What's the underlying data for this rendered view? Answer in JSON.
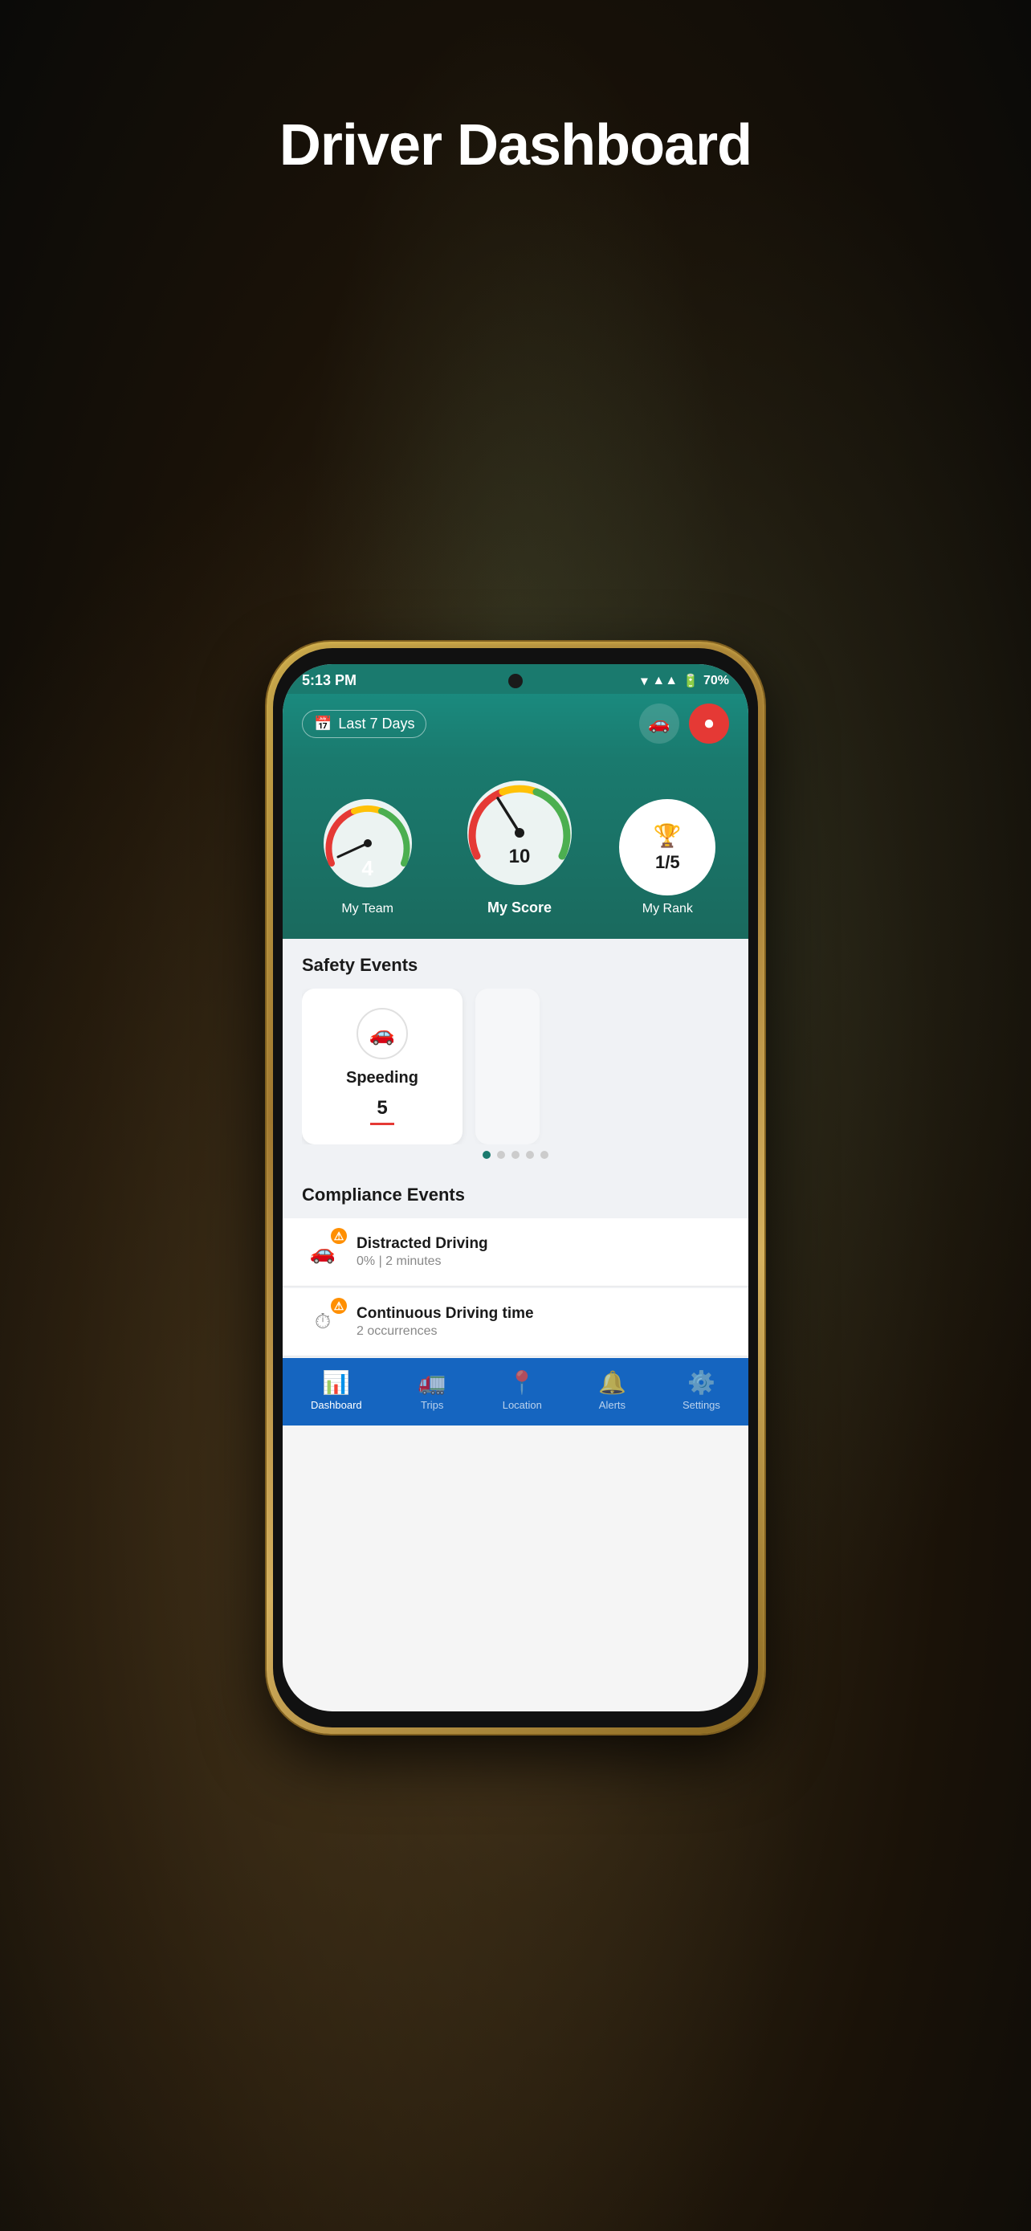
{
  "page": {
    "title": "Driver Dashboard",
    "background": "#1a1a1a"
  },
  "status_bar": {
    "time": "5:13 PM",
    "battery": "70%",
    "signal": "▲▲▲",
    "wifi": "wifi"
  },
  "header": {
    "date_filter": "Last 7 Days",
    "car_icon": "🚗",
    "record_icon": "⏺"
  },
  "scores": {
    "my_team": {
      "label": "My Team",
      "value": "4"
    },
    "my_score": {
      "label": "My Score",
      "value": "10"
    },
    "my_rank": {
      "label": "My Rank",
      "value": "1/5"
    }
  },
  "safety_events": {
    "title": "Safety Events",
    "items": [
      {
        "name": "Speeding",
        "count": "5"
      }
    ],
    "dots": 5,
    "active_dot": 0
  },
  "compliance_events": {
    "title": "Compliance Events",
    "items": [
      {
        "name": "Distracted Driving",
        "detail": "0% | 2 minutes"
      },
      {
        "name": "Continuous Driving time",
        "detail": "2 occurrences"
      }
    ]
  },
  "bottom_nav": {
    "items": [
      {
        "label": "Dashboard",
        "icon": "📊",
        "active": true
      },
      {
        "label": "Trips",
        "icon": "🚛",
        "active": false
      },
      {
        "label": "Location",
        "icon": "📍",
        "active": false
      },
      {
        "label": "Alerts",
        "icon": "🔔",
        "active": false
      },
      {
        "label": "Settings",
        "icon": "⚙️",
        "active": false
      }
    ]
  }
}
